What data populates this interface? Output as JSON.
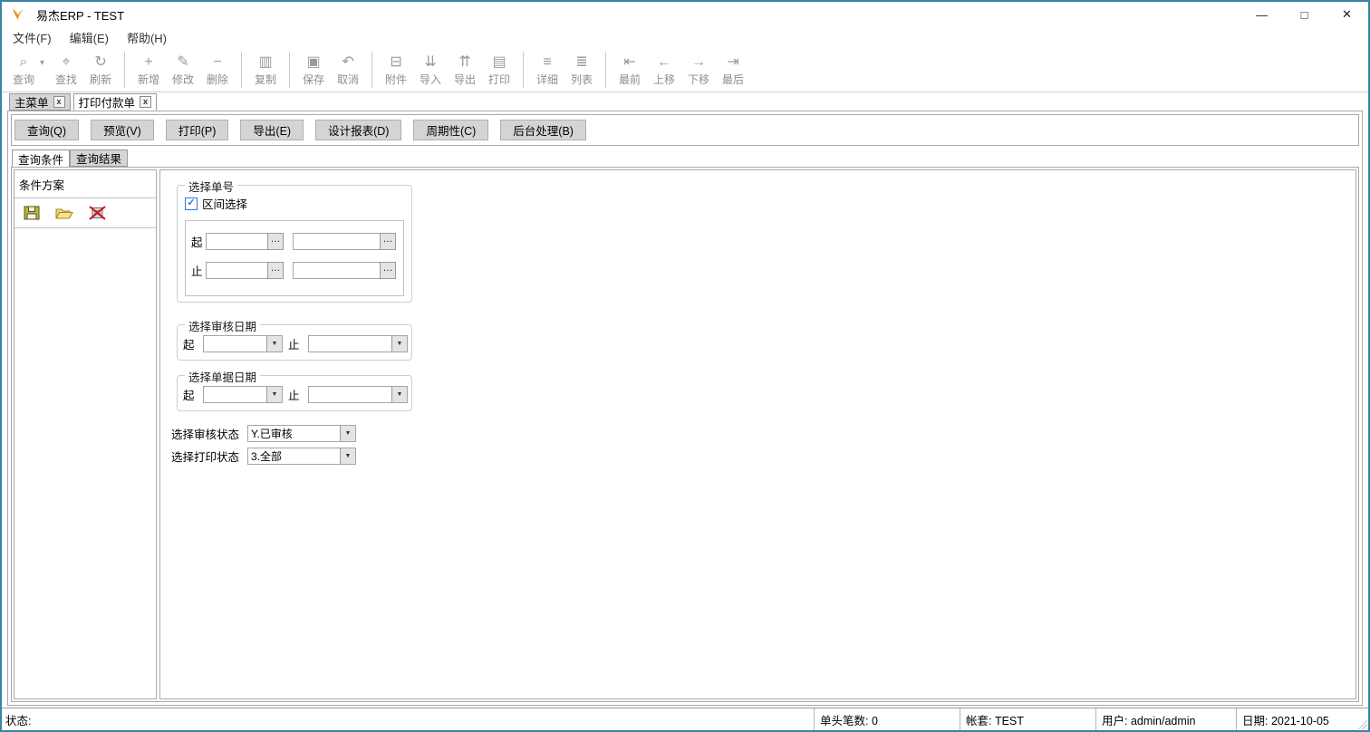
{
  "window": {
    "title": "易杰ERP - TEST"
  },
  "colors": {
    "window_border": "#3b83a5",
    "logo_orange": "#ef8b1d",
    "checkbox_accent": "#2b7cd3",
    "disabled_icon_gray": "#9a9a9a",
    "button_gray": "#d4d4d4",
    "delete_cross_red": "#cc1111"
  },
  "icons": {
    "minimize": "—",
    "maximize": "□",
    "close": "✕",
    "caret_down": "▾",
    "tab_close": "x",
    "ellipsis": "…",
    "combo_arrow": "▼",
    "check": "✓",
    "query": "⌕",
    "find": "⌖",
    "refresh": "↻",
    "add": "+",
    "modify": "✎",
    "delete": "−",
    "copy": "▥",
    "save": "▣",
    "cancel": "↶",
    "attach": "⊟",
    "import": "⇊",
    "export": "⇈",
    "print": "▤",
    "detail": "≡",
    "list": "≣",
    "first": "⇤",
    "up": "←",
    "down": "→",
    "last": "⇥"
  },
  "menu": {
    "items": [
      {
        "label": "文件(F)"
      },
      {
        "label": "编辑(E)"
      },
      {
        "label": "帮助(H)"
      }
    ]
  },
  "toolbar": {
    "items": [
      {
        "label": "查询"
      },
      {
        "label": "查找"
      },
      {
        "label": "刷新"
      },
      {
        "label": "新增"
      },
      {
        "label": "修改"
      },
      {
        "label": "删除"
      },
      {
        "label": "复制"
      },
      {
        "label": "保存"
      },
      {
        "label": "取消"
      },
      {
        "label": "附件"
      },
      {
        "label": "导入"
      },
      {
        "label": "导出"
      },
      {
        "label": "打印"
      },
      {
        "label": "详细"
      },
      {
        "label": "列表"
      },
      {
        "label": "最前"
      },
      {
        "label": "上移"
      },
      {
        "label": "下移"
      },
      {
        "label": "最后"
      }
    ]
  },
  "doc_tabs": {
    "tabs": [
      {
        "label": "主菜单"
      },
      {
        "label": "打印付款单",
        "active": true
      }
    ]
  },
  "action_buttons": {
    "query": "查询(Q)",
    "preview": "预览(V)",
    "print": "打印(P)",
    "export": "导出(E)",
    "design_report": "设计报表(D)",
    "periodic": "周期性(C)",
    "background": "后台处理(B)"
  },
  "query_tabs": {
    "condition": "查询条件",
    "result": "查询结果"
  },
  "scheme_panel": {
    "title": "条件方案"
  },
  "form": {
    "doc_no_group": {
      "legend": "选择单号",
      "range_checkbox_label": "区间选择",
      "range_checked": true,
      "from_label": "起",
      "to_label": "止",
      "from_value_1": "",
      "from_value_2": "",
      "to_value_1": "",
      "to_value_2": ""
    },
    "audit_date_group": {
      "legend": "选择审核日期",
      "from_label": "起",
      "to_label": "止",
      "from_value": "",
      "to_value": ""
    },
    "doc_date_group": {
      "legend": "选择单据日期",
      "from_label": "起",
      "to_label": "止",
      "from_value": "",
      "to_value": ""
    },
    "audit_status": {
      "label": "选择审核状态",
      "value": "Y.已审核"
    },
    "print_status": {
      "label": "选择打印状态",
      "value": "3.全部"
    }
  },
  "status_bar": {
    "status_label": "状态:",
    "header_count": "单头笔数: 0",
    "account": "帐套: TEST",
    "user": "用户: admin/admin",
    "date": "日期: 2021-10-05"
  }
}
